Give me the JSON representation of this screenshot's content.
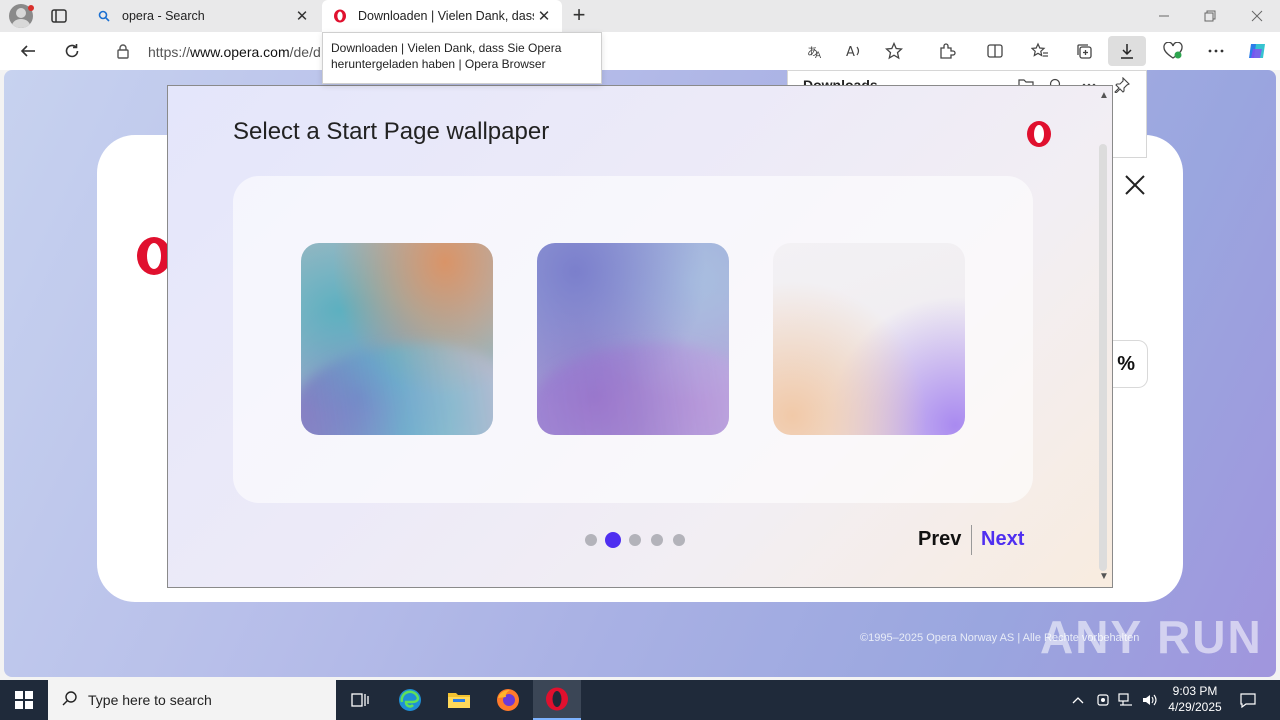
{
  "browser": {
    "tabs": [
      {
        "title": "opera - Search",
        "icon": "search-icon"
      },
      {
        "title": "Downloaden | Vielen Dank, dass Sie Opera heruntergeladen haben | Opera Browser",
        "icon": "opera-icon"
      }
    ],
    "tooltip": "Downloaden | Vielen Dank, dass Sie Opera heruntergeladen haben | Opera Browser",
    "address": {
      "prefix": "https://",
      "host": "www.opera.com",
      "path": "/de/d"
    }
  },
  "downloads_panel": {
    "title": "Downloads"
  },
  "page": {
    "percent": "%",
    "copyright": "©1995–2025 Opera Norway AS | Alle Rechte vorbehalten",
    "watermark": "ANY RUN"
  },
  "installer": {
    "title": "Select a Start Page wallpaper",
    "wallpapers": [
      {
        "name": "wallpaper-1"
      },
      {
        "name": "wallpaper-2"
      },
      {
        "name": "wallpaper-3"
      }
    ],
    "pagination": {
      "total": 5,
      "current": 2
    },
    "prev_label": "Prev",
    "next_label": "Next",
    "accent_color": "#4f2ff0"
  },
  "taskbar": {
    "search_placeholder": "Type here to search",
    "time": "9:03 PM",
    "date": "4/29/2025"
  }
}
